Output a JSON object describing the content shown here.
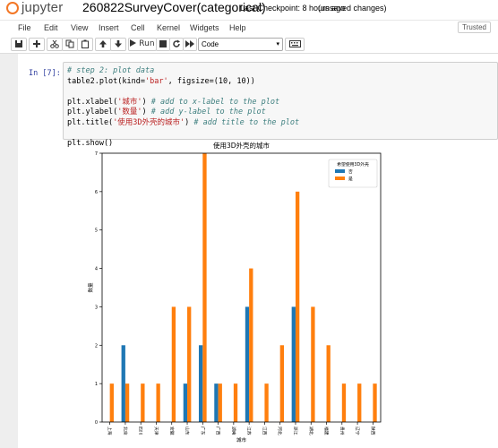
{
  "header": {
    "logo_text": "jupyter",
    "notebook_title": "260822SurveyCover(categorical)",
    "checkpoint": "Last Checkpoint: 8 hours ago",
    "unsaved": "(unsaved changes)"
  },
  "menu": [
    "File",
    "Edit",
    "View",
    "Insert",
    "Cell",
    "Kernel",
    "Widgets",
    "Help"
  ],
  "trusted_label": "Trusted",
  "toolbar": {
    "run_label": "Run",
    "cell_type": "Code",
    "icons": [
      "save-icon",
      "plus-icon",
      "cut-icon",
      "copy-icon",
      "paste-icon",
      "arrow-up-icon",
      "arrow-down-icon",
      "run-icon",
      "stop-icon",
      "restart-icon",
      "fast-forward-icon",
      "keyboard-icon"
    ]
  },
  "cell": {
    "prompt": "In [7]:",
    "code": {
      "l1_comment": "# step 2: plot data",
      "l2_pre": "table2.plot(kind=",
      "l2_str": "'bar'",
      "l2_post": ", figsize=(10, 10))",
      "l4_pre": "plt.xlabel(",
      "l4_str": "'城市'",
      "l4_post": ") ",
      "l4_comment": "# add to x-label to the plot",
      "l5_pre": "plt.ylabel(",
      "l5_str": "'数量'",
      "l5_post": ") ",
      "l5_comment": "# add y-label to the plot",
      "l6_pre": "plt.title(",
      "l6_str": "'使用3D外壳的城市'",
      "l6_post": ") ",
      "l6_comment": "# add title to the plot",
      "l8": "plt.show()"
    }
  },
  "chart_data": {
    "type": "bar",
    "title": "使用3D外壳的城市",
    "xlabel": "城市",
    "ylabel": "数量",
    "ylim": [
      0,
      7
    ],
    "yticks": [
      0,
      1,
      2,
      3,
      4,
      5,
      6,
      7
    ],
    "categories": [
      "上海",
      "北京",
      "四川",
      "天津",
      "安徽",
      "山东",
      "广东",
      "广西",
      "湖南",
      "江苏",
      "江西",
      "河北",
      "浙江",
      "湖北",
      "福建",
      "贵州",
      "辽宁",
      "陕西"
    ],
    "legend_title": "希望使用3D外壳",
    "legend_position": "top-right",
    "series": [
      {
        "name": "否",
        "color": "#1f77b4",
        "values": [
          0,
          2,
          0,
          0,
          0,
          1,
          2,
          1,
          0,
          3,
          0,
          0,
          3,
          0,
          0,
          0,
          0,
          0
        ]
      },
      {
        "name": "是",
        "color": "#ff7f0e",
        "values": [
          1,
          1,
          1,
          1,
          3,
          3,
          7,
          1,
          1,
          4,
          1,
          2,
          6,
          3,
          2,
          1,
          1,
          1
        ]
      }
    ]
  }
}
